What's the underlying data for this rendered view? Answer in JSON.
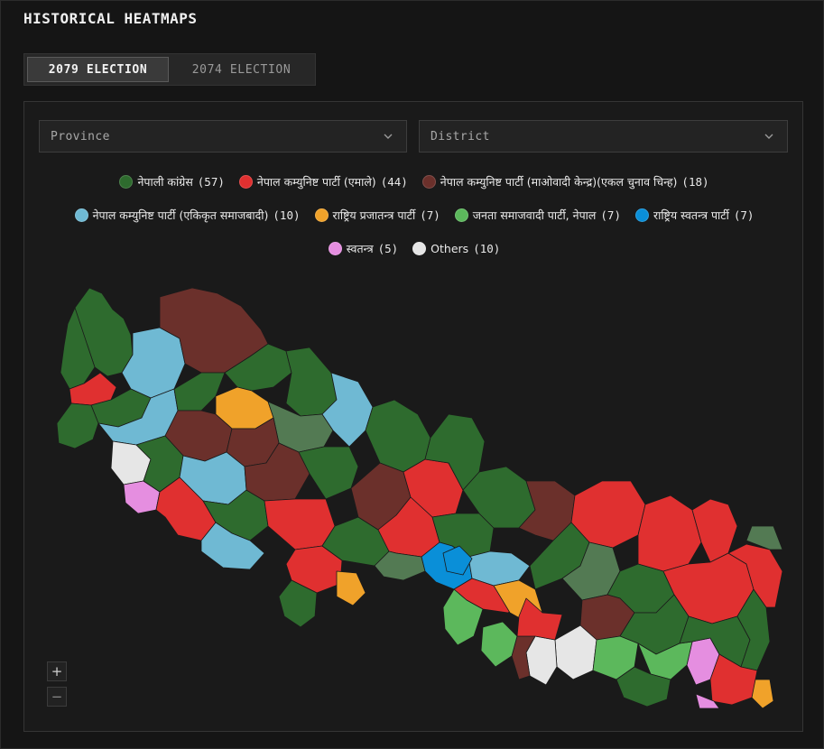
{
  "page": {
    "title": "HISTORICAL HEATMAPS"
  },
  "tabs": [
    {
      "label": "2079 ELECTION",
      "active": true
    },
    {
      "label": "2074 ELECTION",
      "active": false
    }
  ],
  "filters": {
    "province": {
      "value": "Province"
    },
    "district": {
      "value": "District"
    }
  },
  "legend": [
    {
      "label": "नेपाली कांग्रेस",
      "count": "(57)",
      "color": "#2e6b2e"
    },
    {
      "label": "नेपाल कम्युनिष्ट पार्टी (एमाले)",
      "count": "(44)",
      "color": "#e03030"
    },
    {
      "label": "नेपाल कम्युनिष्ट पार्टी (माओवादी केन्द्र)(एकल चुनाव चिन्ह)",
      "count": "(18)",
      "color": "#6b302b"
    },
    {
      "label": "नेपाल कम्युनिष्ट पार्टी (एकिकृत समाजबादी)",
      "count": "(10)",
      "color": "#6fb9d3"
    },
    {
      "label": "राष्ट्रिय प्रजातन्त्र पार्टी",
      "count": "(7)",
      "color": "#f0a22a"
    },
    {
      "label": "जनता समाजवादी पार्टी, नेपाल",
      "count": "(7)",
      "color": "#5cb85c"
    },
    {
      "label": "राष्ट्रिय स्वतन्त्र पार्टी",
      "count": "(7)",
      "color": "#0a8fd8"
    },
    {
      "label": "स्वतन्त्र",
      "count": "(5)",
      "color": "#e58ee0"
    },
    {
      "label": "Others",
      "count": "(10)",
      "color": "#e6e6e6"
    }
  ],
  "colors": {
    "nc": "#2e6b2e",
    "uml": "#e03030",
    "maoist": "#6b302b",
    "unified": "#6fb9d3",
    "rpp": "#f0a22a",
    "jsp": "#5cb85c",
    "rsp": "#0a8fd8",
    "independent": "#e58ee0",
    "others": "#e6e6e6",
    "nc_alt": "#537a53",
    "maoist_alt": "#5a2f2b"
  },
  "map": {
    "regions": [
      {
        "party": "nc"
      },
      {
        "party": "nc"
      },
      {
        "party": "unified"
      },
      {
        "party": "maoist"
      },
      {
        "party": "uml"
      },
      {
        "party": "nc"
      },
      {
        "party": "unified"
      },
      {
        "party": "nc"
      },
      {
        "party": "nc"
      },
      {
        "party": "nc"
      },
      {
        "party": "rpp"
      },
      {
        "party": "nc_alt"
      },
      {
        "party": "unified"
      },
      {
        "party": "nc"
      },
      {
        "party": "maoist"
      },
      {
        "party": "maoist"
      },
      {
        "party": "nc"
      },
      {
        "party": "others"
      },
      {
        "party": "independent"
      },
      {
        "party": "nc"
      },
      {
        "party": "unified"
      },
      {
        "party": "uml"
      },
      {
        "party": "nc"
      },
      {
        "party": "unified"
      },
      {
        "party": "maoist"
      },
      {
        "party": "nc"
      },
      {
        "party": "uml"
      },
      {
        "party": "uml"
      },
      {
        "party": "nc"
      },
      {
        "party": "maoist"
      },
      {
        "party": "uml"
      },
      {
        "party": "nc"
      },
      {
        "party": "uml"
      },
      {
        "party": "nc"
      },
      {
        "party": "nc_alt"
      },
      {
        "party": "nc"
      },
      {
        "party": "rsp"
      },
      {
        "party": "unified"
      },
      {
        "party": "uml"
      },
      {
        "party": "rpp"
      },
      {
        "party": "jsp"
      },
      {
        "party": "nc"
      },
      {
        "party": "maoist"
      },
      {
        "party": "uml"
      },
      {
        "party": "nc"
      },
      {
        "party": "nc_alt"
      },
      {
        "party": "uml"
      },
      {
        "party": "uml"
      },
      {
        "party": "nc"
      },
      {
        "party": "uml"
      },
      {
        "party": "maoist"
      },
      {
        "party": "nc"
      },
      {
        "party": "others"
      },
      {
        "party": "independent"
      },
      {
        "party": "jsp"
      },
      {
        "party": "others"
      },
      {
        "party": "jsp"
      },
      {
        "party": "nc"
      },
      {
        "party": "nc"
      },
      {
        "party": "rpp"
      },
      {
        "party": "uml"
      },
      {
        "party": "others"
      },
      {
        "party": "nc"
      },
      {
        "party": "uml"
      },
      {
        "party": "independent"
      },
      {
        "party": "nc_alt"
      },
      {
        "party": "maoist"
      },
      {
        "party": "jsp"
      },
      {
        "party": "uml"
      },
      {
        "party": "rsp"
      },
      {
        "party": "rpp"
      }
    ]
  },
  "zoom": {
    "in_label": "+",
    "out_label": "−"
  }
}
